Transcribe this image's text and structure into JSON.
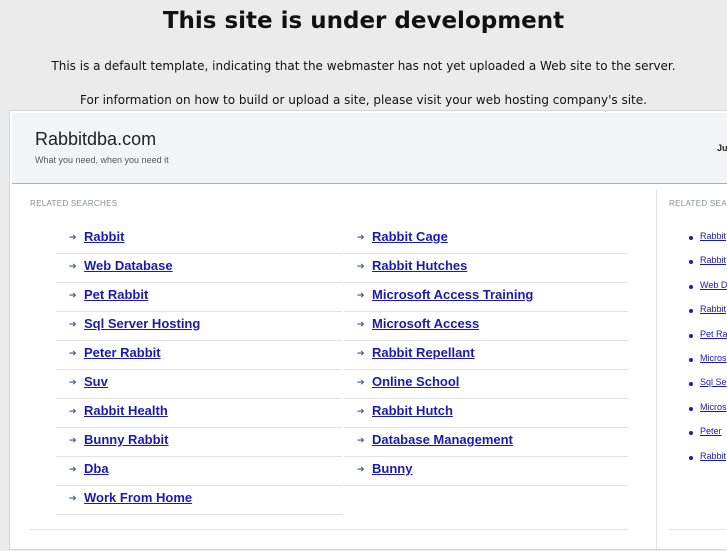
{
  "header": {
    "title": "This site is under development",
    "line1": "This is a default template, indicating that the webmaster has not yet uploaded a Web site to the server.",
    "line2": "For information on how to build or upload a site, please visit your web hosting company's site."
  },
  "site": {
    "name": "Rabbitdba.com",
    "tagline": "What you need, when you need it",
    "right_text": "Ju"
  },
  "main": {
    "title": "RELATED SEARCHES",
    "left_links": [
      "Rabbit",
      "Web Database",
      "Pet Rabbit",
      "Sql Server Hosting",
      "Peter Rabbit",
      "Suv",
      "Rabbit Health",
      "Bunny Rabbit",
      "Dba",
      "Work From Home"
    ],
    "right_links": [
      "Rabbit Cage",
      "Rabbit Hutches",
      "Microsoft Access Training",
      "Microsoft Access",
      "Rabbit Repellant",
      "Online School",
      "Rabbit Hutch",
      "Database Management",
      "Bunny"
    ]
  },
  "sidebar": {
    "title": "RELATED SEA",
    "links": [
      "Rabbit",
      "Rabbit",
      "Web D",
      "Rabbit",
      "Pet Ra",
      "Micros",
      "Sql Se",
      "Micros",
      "Peter",
      "Rabbit"
    ]
  },
  "icons": {
    "arrow": "right-arrow-icon",
    "bullet": "bullet-icon"
  },
  "colors": {
    "link": "#1a1ab6",
    "topbar_bg": "#f1f5f8",
    "page_bg": "#ebebeb"
  }
}
